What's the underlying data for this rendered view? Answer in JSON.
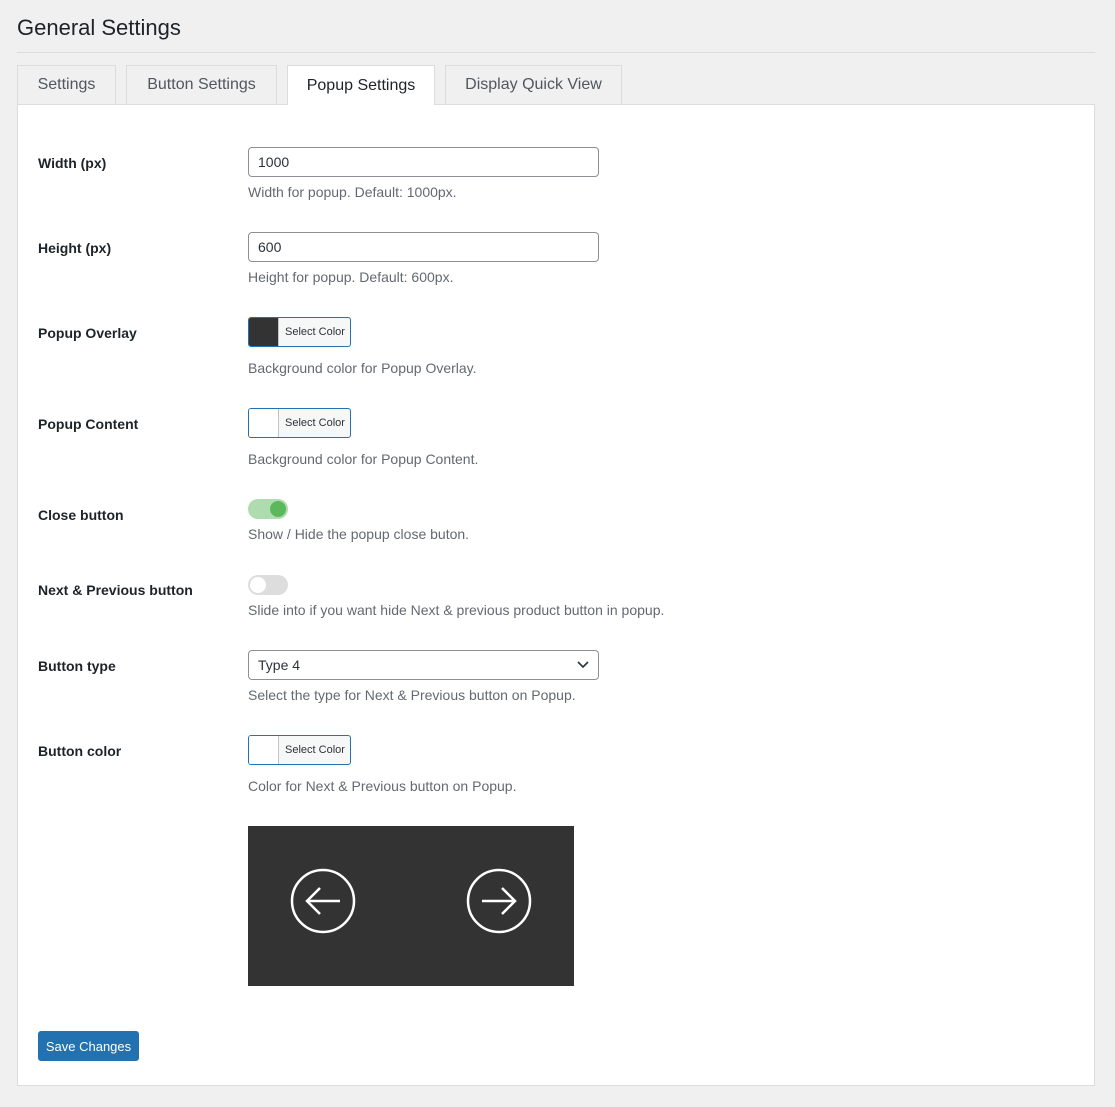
{
  "page_title": "General Settings",
  "tabs": [
    {
      "label": "Settings"
    },
    {
      "label": "Button Settings"
    },
    {
      "label": "Popup Settings"
    },
    {
      "label": "Display Quick View"
    }
  ],
  "fields": {
    "width": {
      "label": "Width (px)",
      "value": "1000",
      "desc": "Width for popup. Default: 1000px."
    },
    "height": {
      "label": "Height (px)",
      "value": "600",
      "desc": "Height for popup. Default: 600px."
    },
    "overlay": {
      "label": "Popup Overlay",
      "button": "Select Color",
      "color": "#333333",
      "desc": "Background color for Popup Overlay."
    },
    "content": {
      "label": "Popup Content",
      "button": "Select Color",
      "color": "#ffffff",
      "desc": "Background color for Popup Content."
    },
    "close": {
      "label": "Close button",
      "on": true,
      "desc": "Show / Hide the popup close buton."
    },
    "nextprev": {
      "label": "Next & Previous button",
      "on": false,
      "desc": "Slide into if you want hide Next & previous product button in popup."
    },
    "button_type": {
      "label": "Button type",
      "value": "Type 4",
      "desc": "Select the type for Next & Previous button on Popup."
    },
    "button_color": {
      "label": "Button color",
      "button": "Select Color",
      "color": "#ffffff",
      "desc": "Color for Next & Previous button on Popup."
    }
  },
  "preview": {
    "left_icon": "arrow-left-circle-icon",
    "right_icon": "arrow-right-circle-icon",
    "bg": "#333333"
  },
  "save_label": "Save Changes"
}
